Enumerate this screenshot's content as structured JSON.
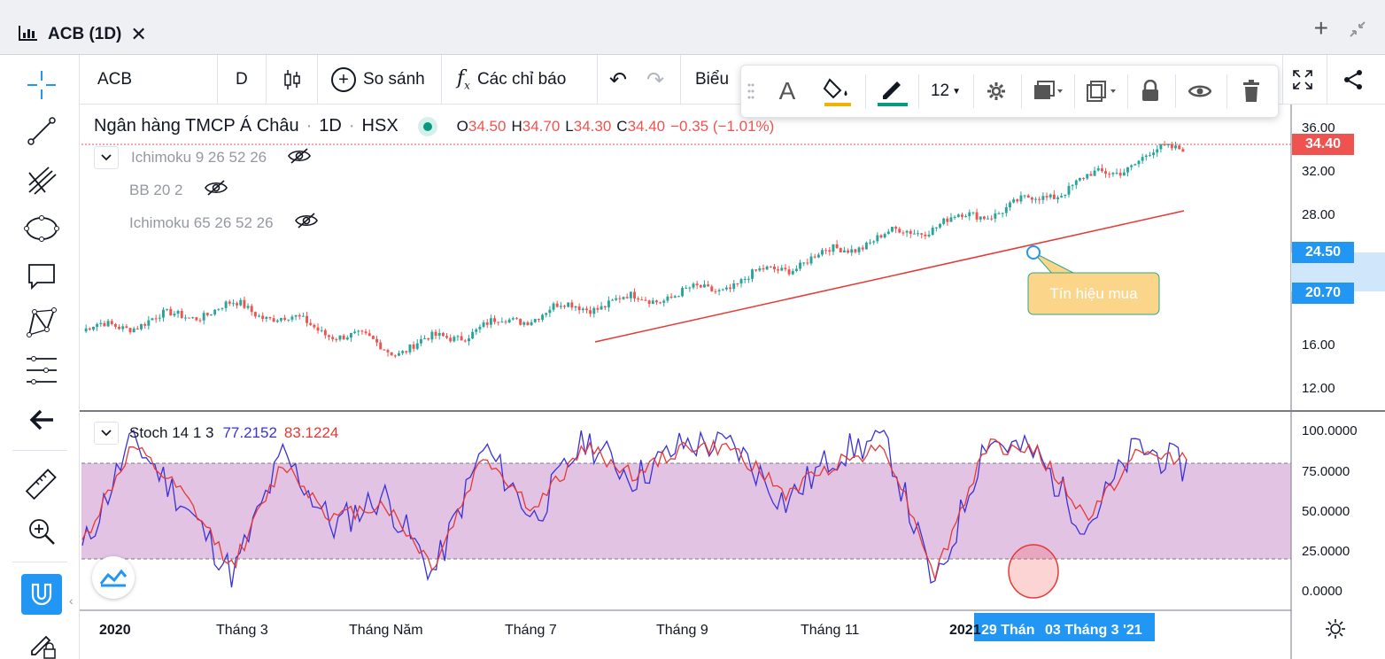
{
  "window": {
    "title": "ACB (1D)",
    "icons": [
      "chart-type-icon",
      "close-icon",
      "add-icon",
      "collapse-icon"
    ]
  },
  "toolbar": {
    "symbol": "ACB",
    "interval": "D",
    "compare_label": "So sánh",
    "indicators_label": "Các chỉ báo",
    "chart_label": "Biểu"
  },
  "floating_toolbar": {
    "font_size": "12",
    "colors": {
      "fill_underline": "#f2b200",
      "pen_underline": "#089981"
    }
  },
  "legend": {
    "name": "Ngân hàng TMCP Á Châu",
    "sep1": "·",
    "interval": "1D",
    "sep2": "·",
    "exchange": "HSX",
    "o_label": "O",
    "o_value": "34.50",
    "h_label": "H",
    "h_value": "34.70",
    "l_label": "L",
    "l_value": "34.30",
    "c_label": "C",
    "c_value": "34.40",
    "change": "−0.35 (−1.01%)",
    "indicators": [
      {
        "label": "Ichimoku 9 26 52 26"
      },
      {
        "label": "BB 20 2"
      },
      {
        "label": "Ichimoku 65 26 52 26"
      }
    ]
  },
  "stoch": {
    "label": "Stoch 14 1 3",
    "k_value": "77.2152",
    "d_value": "83.1224",
    "colors": {
      "k": "#3a32d6",
      "d": "#e53935",
      "band": "#e2c0e3"
    }
  },
  "callout": {
    "text": "Tín hiệu mua",
    "colors": {
      "bg": "#fad58a",
      "border": "#2fa58a",
      "text": "#ffffff"
    }
  },
  "price_scale": {
    "ticks": [
      "36.00",
      "32.00",
      "28.00",
      "16.00",
      "12.00"
    ],
    "last_price": "34.40",
    "marker_1": "24.50",
    "marker_2": "20.70"
  },
  "stoch_scale": {
    "ticks": [
      "100.0000",
      "75.0000",
      "50.0000",
      "25.0000",
      "0.0000"
    ]
  },
  "time_scale": {
    "ticks": [
      "2020",
      "Tháng 3",
      "Tháng Năm",
      "Tháng 7",
      "Tháng 9",
      "Tháng 11",
      "2021"
    ],
    "crosshair_label_1": "29 Thán",
    "crosshair_label_2": "03 Tháng 3 '21"
  },
  "colors": {
    "up": "#26a69a",
    "down": "#ef5350",
    "trendline": "#e53935",
    "accent": "#2196f3"
  },
  "chart_data": [
    {
      "type": "candlestick",
      "title": "Ngân hàng TMCP Á Châu · 1D · HSX",
      "ylim": [
        12,
        36
      ],
      "x": [
        "2020",
        "Tháng 3",
        "Tháng Năm",
        "Tháng 7",
        "Tháng 9",
        "Tháng 11",
        "2021",
        "Tháng 3"
      ],
      "close": [
        17.2,
        19.5,
        15.5,
        19.2,
        21.0,
        25.5,
        29.0,
        34.4
      ],
      "annotations": [
        "Tín hiệu mua"
      ]
    },
    {
      "type": "line",
      "title": "Stoch 14 1 3",
      "ylim": [
        0,
        100
      ],
      "series": [
        {
          "name": "%K",
          "values": [
            25,
            95,
            55,
            10,
            85,
            40,
            60,
            10,
            90,
            45,
            95,
            70,
            92,
            90,
            55,
            85,
            95,
            0,
            95,
            85,
            40,
            90,
            77
          ]
        },
        {
          "name": "%D",
          "values": [
            30,
            90,
            60,
            15,
            80,
            45,
            55,
            15,
            85,
            50,
            90,
            72,
            90,
            88,
            60,
            80,
            90,
            10,
            90,
            88,
            45,
            85,
            83
          ]
        }
      ]
    }
  ]
}
